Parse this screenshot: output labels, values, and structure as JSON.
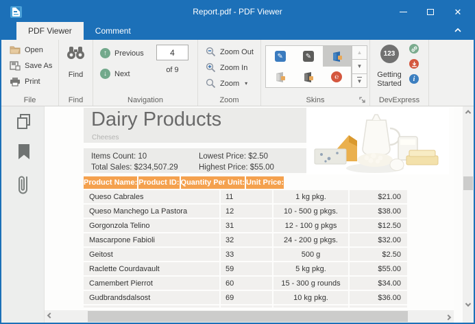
{
  "window": {
    "title": "Report.pdf - PDF Viewer"
  },
  "tabs": {
    "items": [
      {
        "label": "PDF Viewer",
        "active": true
      },
      {
        "label": "Comment",
        "active": false
      }
    ]
  },
  "ribbon": {
    "file": {
      "label": "File",
      "open": "Open",
      "save_as": "Save As",
      "print": "Print"
    },
    "find": {
      "label": "Find",
      "button": "Find"
    },
    "navigation": {
      "label": "Navigation",
      "previous": "Previous",
      "next": "Next",
      "page_value": "4",
      "page_of": "of 9"
    },
    "zoom": {
      "label": "Zoom",
      "zoom_out": "Zoom Out",
      "zoom_in": "Zoom In",
      "zoom_menu": "Zoom"
    },
    "skins": {
      "label": "Skins",
      "selected_index": 2,
      "items": [
        "bezier-blue-skin-icon",
        "bezier-dark-skin-icon",
        "office-blue-skin-icon",
        "office-light-skin-icon",
        "office-dark-skin-icon",
        "pumpkin-red-skin-icon"
      ]
    },
    "devexpress": {
      "label": "DevExpress",
      "badge": "123",
      "getting_started": "Getting Started"
    }
  },
  "sidebar_icons": [
    "thumbnails-icon",
    "bookmarks-icon",
    "attachments-icon"
  ],
  "document": {
    "title": "Dairy Products",
    "subtitle": "Cheeses",
    "stats": {
      "items_count": "Items Count: 10",
      "total_sales": "Total Sales: $234,507.29",
      "lowest_price": "Lowest Price: $2.50",
      "highest_price": "Highest Price: $55.00"
    },
    "table": {
      "headers": [
        "Product Name:",
        "Product ID:",
        "Quantity Per Unit:",
        "Unit Price:"
      ],
      "rows": [
        [
          "Queso Cabrales",
          "11",
          "1 kg pkg.",
          "$21.00"
        ],
        [
          "Queso Manchego La Pastora",
          "12",
          "10 - 500 g pkgs.",
          "$38.00"
        ],
        [
          "Gorgonzola Telino",
          "31",
          "12 - 100 g pkgs",
          "$12.50"
        ],
        [
          "Mascarpone Fabioli",
          "32",
          "24 - 200 g pkgs.",
          "$32.00"
        ],
        [
          "Geitost",
          "33",
          "500 g",
          "$2.50"
        ],
        [
          "Raclette Courdavault",
          "59",
          "5 kg pkg.",
          "$55.00"
        ],
        [
          "Camembert Pierrot",
          "60",
          "15 - 300 g rounds",
          "$34.00"
        ],
        [
          "Gudbrandsdalsost",
          "69",
          "10 kg pkg.",
          "$36.00"
        ]
      ]
    }
  },
  "colors": {
    "titlebar_blue": "#1c70b8",
    "ribbon_bg": "#f1f1f0",
    "table_header_orange": "#f4a14e",
    "table_row_bg": "#f1f0ee",
    "doc_header_bg": "#ebebe9",
    "nav_green": "#73a98c",
    "devexpress_green": "#7aab8e",
    "devexpress_red": "#d4573e",
    "devexpress_blue": "#3c7fc0"
  }
}
